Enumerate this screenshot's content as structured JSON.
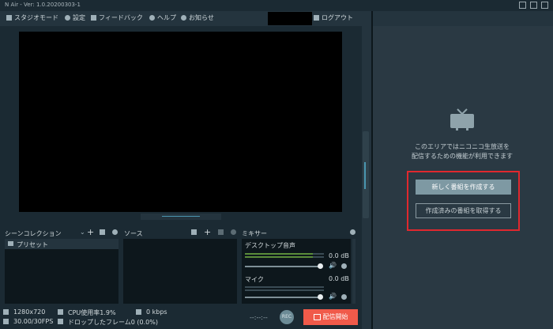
{
  "window": {
    "title": "N Air - Ver: 1.0.20200303-1"
  },
  "menu": {
    "studio_mode": "スタジオモード",
    "settings": "設定",
    "feedback": "フィードバック",
    "help": "ヘルプ",
    "news": "お知らせ",
    "logout": "ログアウト"
  },
  "right_panel": {
    "message_line1": "このエリアではニコニコ生放送を",
    "message_line2": "配信するための機能が利用できます",
    "create_button": "新しく番組を作成する",
    "fetch_button": "作成済みの番組を取得する"
  },
  "scenes": {
    "title": "シーンコレクション",
    "items": [
      "プリセット"
    ]
  },
  "sources": {
    "title": "ソース"
  },
  "mixer": {
    "title": "ミキサー",
    "channels": [
      {
        "name": "デスクトップ音声",
        "level": "0.0 dB"
      },
      {
        "name": "マイク",
        "level": "0.0 dB"
      }
    ]
  },
  "status": {
    "resolution": "1280x720",
    "cpu": "CPU使用率1.9%",
    "bitrate": "0 kbps",
    "fps": "30.00/30FPS",
    "dropped": "ドロップしたフレーム0 (0.0%)",
    "timer": "--:--:--",
    "rec_label": "REC",
    "go_live": "配信開始"
  },
  "colors": {
    "accent_live": "#f05a4a",
    "highlight_box": "#e0282e",
    "primary_button": "#7e99a3"
  }
}
